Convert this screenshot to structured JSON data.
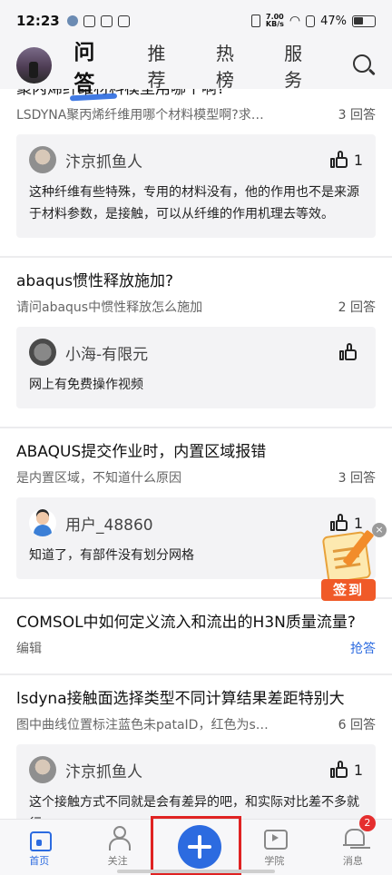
{
  "status_bar": {
    "time": "12:23",
    "net_speed_value": "7.00",
    "net_speed_unit": "KB/s",
    "battery": "47%"
  },
  "top_nav": {
    "tabs": [
      {
        "label": "问答",
        "active": true
      },
      {
        "label": "推荐",
        "active": false
      },
      {
        "label": "热榜",
        "active": false
      },
      {
        "label": "服务",
        "active": false
      }
    ]
  },
  "posts": [
    {
      "title": "聚丙烯纤维材料模型用哪个啊?",
      "excerpt": "LSDYNA聚丙烯纤维用哪个材料模型啊?求…",
      "count": "3 回答",
      "reply": {
        "user": "汴京抓鱼人",
        "likes": "1",
        "text": "这种纤维有些特殊，专用的材料没有，他的作用也不是来源于材料参数，是接触，可以从纤维的作用机理去等效。"
      }
    },
    {
      "title": "abaqus惯性释放施加?",
      "excerpt": "请问abaqus中惯性释放怎么施加",
      "count": "2 回答",
      "reply": {
        "user": "小海-有限元",
        "likes": "",
        "text": "网上有免费操作视频"
      }
    },
    {
      "title": "ABAQUS提交作业时，内置区域报错",
      "excerpt": "是内置区域，不知道什么原因",
      "count": "3 回答",
      "reply": {
        "user": "用户_48860",
        "likes": "1",
        "text": "知道了，有部件没有划分网格"
      }
    },
    {
      "title": "COMSOL中如何定义流入和流出的H3N质量流量?",
      "excerpt": "编辑",
      "count": "抢答"
    },
    {
      "title": "lsdyna接触面选择类型不同计算结果差距特别大",
      "excerpt": "图中曲线位置标注蓝色未pataID，红色为s…",
      "count": "6 回答",
      "reply": {
        "user": "汴京抓鱼人",
        "likes": "1",
        "text": "这个接触方式不同就是会有差异的吧，和实际对比差不多就行。"
      }
    }
  ],
  "sign_in": {
    "label": "签到",
    "close": "×"
  },
  "bottom_nav": {
    "items": [
      {
        "label": "首页",
        "icon": "home-icon"
      },
      {
        "label": "关注",
        "icon": "user-icon"
      },
      {
        "label": "",
        "icon": "add-icon"
      },
      {
        "label": "学院",
        "icon": "play-icon"
      },
      {
        "label": "消息",
        "icon": "bell-icon",
        "badge": "2"
      }
    ]
  },
  "colors": {
    "accent": "#2c6be0",
    "badge": "#e52e2e",
    "highlight": "#e02222"
  }
}
